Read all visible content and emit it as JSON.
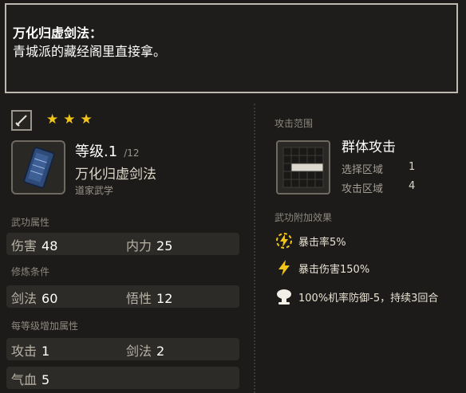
{
  "tooltip": {
    "title": "万化归虚剑法：",
    "description": "青城派的藏经阁里直接拿。"
  },
  "left": {
    "weapon_icon": "sword-icon",
    "stars": [
      "★",
      "★",
      "★"
    ],
    "level": "等级.1",
    "level_max": "/12",
    "skill_name": "万化归虚剑法",
    "school": "道家武学",
    "sections": {
      "martial_attrs": "武功属性",
      "requirements": "修炼条件",
      "per_level": "每等级增加属性"
    },
    "martial_stats": [
      {
        "name": "伤害",
        "value": "48"
      },
      {
        "name": "内力",
        "value": "25"
      }
    ],
    "requirement_stats": [
      {
        "name": "剑法",
        "value": "60"
      },
      {
        "name": "悟性",
        "value": "12"
      }
    ],
    "per_level_stats": [
      {
        "name": "攻击",
        "value": "1"
      },
      {
        "name": "剑法",
        "value": "2"
      },
      {
        "name": "气血",
        "value": "5"
      }
    ]
  },
  "right": {
    "range_label": "攻击范围",
    "range_type": "群体攻击",
    "select_area_label": "选择区域",
    "select_area_value": "1",
    "attack_area_label": "攻击区域",
    "attack_area_value": "4",
    "effects_label": "武功附加效果",
    "effects": [
      {
        "icon": "critical-rate-icon",
        "text": "暴击率5%"
      },
      {
        "icon": "lightning-icon",
        "text": "暴击伤害150%"
      },
      {
        "icon": "mushroom-cloud-icon",
        "text": "100%机率防御-5，持续3回合"
      }
    ]
  }
}
